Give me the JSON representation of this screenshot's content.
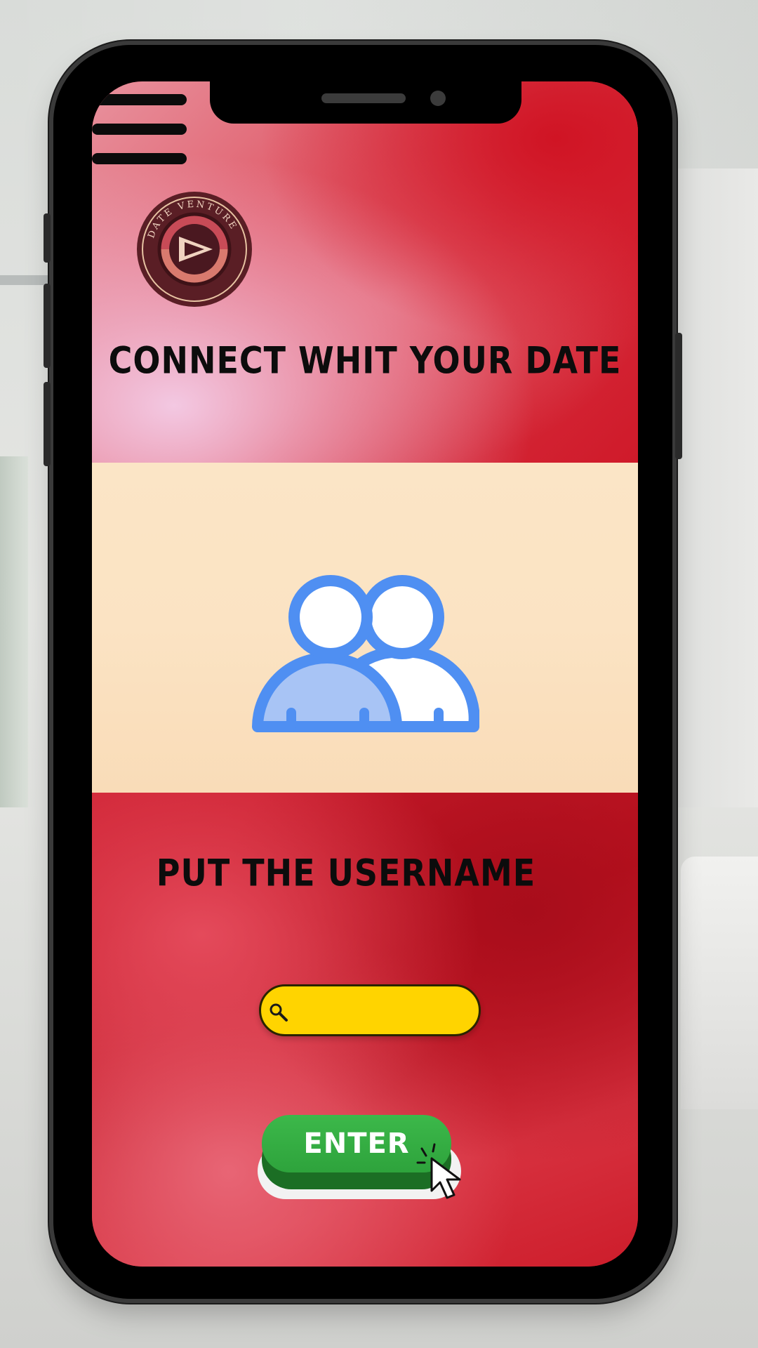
{
  "screen": {
    "header": {
      "title": "CONNECT WHIT YOUR DATE",
      "menu_icon": "hamburger-menu-icon",
      "logo_icon": "date-venture-logo-icon"
    },
    "middle": {
      "icon": "people-icon"
    },
    "form": {
      "prompt": "PUT THE USERNAME",
      "username_value": "",
      "search_icon": "search-icon",
      "submit_label": "ENTER",
      "pointer_icon": "cursor-pointer-icon"
    }
  },
  "colors": {
    "accent_red": "#d21e2a",
    "mid_band": "#fbe3c3",
    "people_blue": "#4f8ff2",
    "people_fill": "#a8c4f5",
    "input_yellow": "#ffd400",
    "button_green": "#2ea33c"
  }
}
